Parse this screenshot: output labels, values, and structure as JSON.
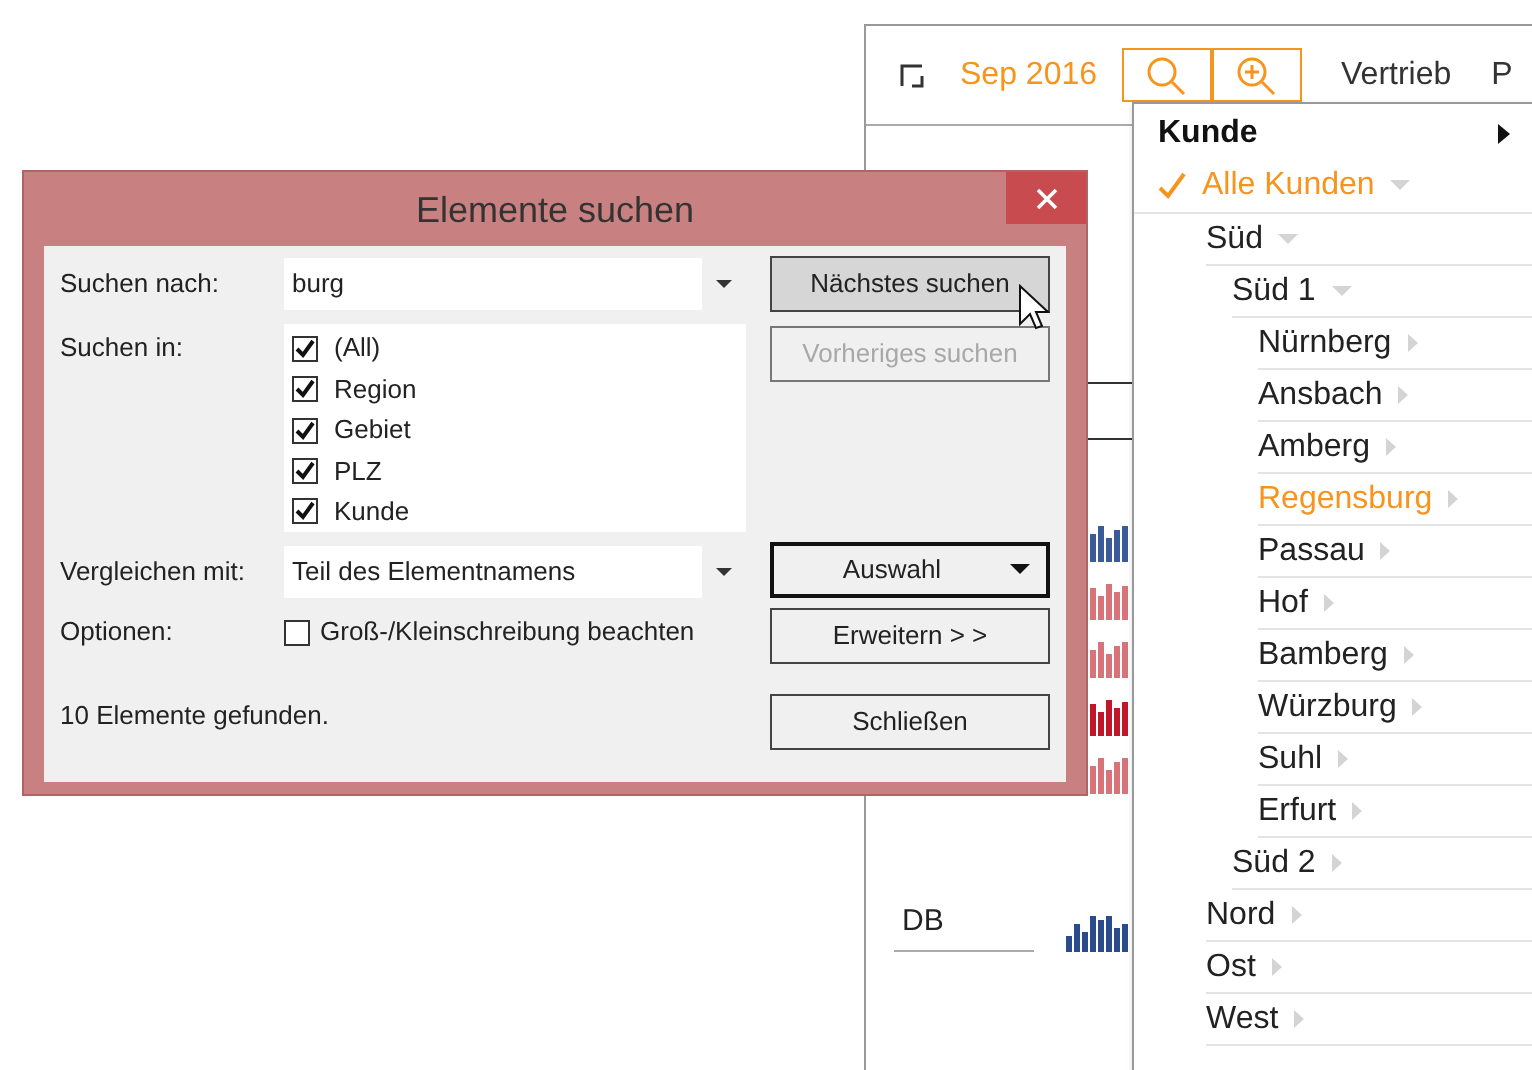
{
  "toolbar": {
    "period": "Sep 2016",
    "tool_buttons": [
      {
        "kind": "search",
        "selected": true
      },
      {
        "kind": "zoom",
        "selected": true
      }
    ],
    "menus": [
      "Vertrieb",
      "P"
    ]
  },
  "panel": {
    "row_label": "DB"
  },
  "menu": {
    "header": "Kunde",
    "root": {
      "label": "Alle Kunden",
      "checked": true,
      "selected": true,
      "expanded": true,
      "children": [
        {
          "label": "Süd",
          "selected": false,
          "expanded": true,
          "children": [
            {
              "label": "Süd 1",
              "selected": false,
              "expanded": true,
              "children": [
                {
                  "label": "Nürnberg",
                  "selected": false,
                  "expanded": false
                },
                {
                  "label": "Ansbach",
                  "selected": false,
                  "expanded": false
                },
                {
                  "label": "Amberg",
                  "selected": false,
                  "expanded": false
                },
                {
                  "label": "Regensburg",
                  "selected": true,
                  "expanded": false
                },
                {
                  "label": "Passau",
                  "selected": false,
                  "expanded": false
                },
                {
                  "label": "Hof",
                  "selected": false,
                  "expanded": false
                },
                {
                  "label": "Bamberg",
                  "selected": false,
                  "expanded": false
                },
                {
                  "label": "Würzburg",
                  "selected": false,
                  "expanded": false
                },
                {
                  "label": "Suhl",
                  "selected": false,
                  "expanded": false
                },
                {
                  "label": "Erfurt",
                  "selected": false,
                  "expanded": false
                }
              ]
            },
            {
              "label": "Süd 2",
              "selected": false,
              "expanded": false
            }
          ]
        },
        {
          "label": "Nord",
          "selected": false,
          "expanded": false
        },
        {
          "label": "Ost",
          "selected": false,
          "expanded": false
        },
        {
          "label": "West",
          "selected": false,
          "expanded": false
        }
      ]
    }
  },
  "dialog": {
    "title": "Elemente suchen",
    "search_label": "Suchen nach:",
    "search_value": "burg",
    "search_in_label": "Suchen in:",
    "search_in": [
      {
        "label": "(All)",
        "checked": true
      },
      {
        "label": "Region",
        "checked": true
      },
      {
        "label": "Gebiet",
        "checked": true
      },
      {
        "label": "PLZ",
        "checked": true
      },
      {
        "label": "Kunde",
        "checked": true
      }
    ],
    "compare_label": "Vergleichen mit:",
    "compare_value": "Teil des Elementnamens",
    "options_label": "Optionen:",
    "options": [
      {
        "label": "Groß-/Kleinschreibung beachten",
        "checked": false
      }
    ],
    "status": "10 Elemente gefunden.",
    "buttons": [
      {
        "label": "Nächstes suchen",
        "kind": "hover",
        "disabled": false
      },
      {
        "label": "Vorheriges suchen",
        "kind": "plain",
        "disabled": true
      },
      {
        "label": "Auswahl",
        "kind": "dropdown",
        "disabled": false
      },
      {
        "label": "Erweitern > >",
        "kind": "plain",
        "disabled": false
      },
      {
        "label": "Schließen",
        "kind": "plain",
        "disabled": false
      }
    ]
  }
}
